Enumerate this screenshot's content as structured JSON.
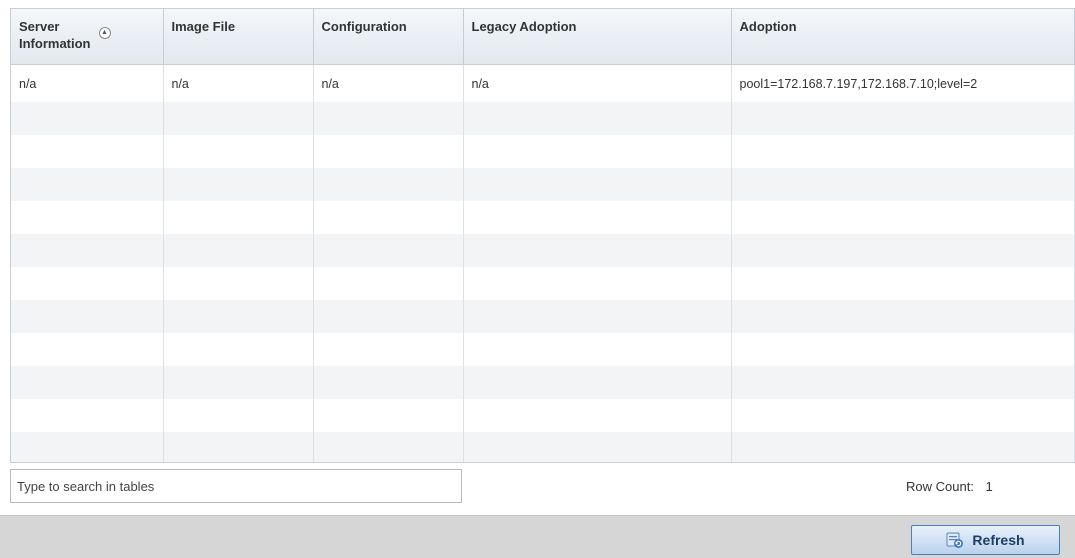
{
  "table": {
    "columns": [
      {
        "label_line1": "Server",
        "label_line2": "Information"
      },
      {
        "label": "Image File"
      },
      {
        "label": "Configuration"
      },
      {
        "label": "Legacy Adoption"
      },
      {
        "label": "Adoption"
      }
    ],
    "sort_indicator": "▲",
    "rows": [
      [
        "n/a",
        "n/a",
        "n/a",
        "n/a",
        "pool1=172.168.7.197,172.168.7.10;level=2"
      ]
    ]
  },
  "search": {
    "placeholder": "Type to search in tables"
  },
  "row_count": {
    "label": "Row Count:",
    "value": "1"
  },
  "footer": {
    "refresh_label": "Refresh"
  }
}
